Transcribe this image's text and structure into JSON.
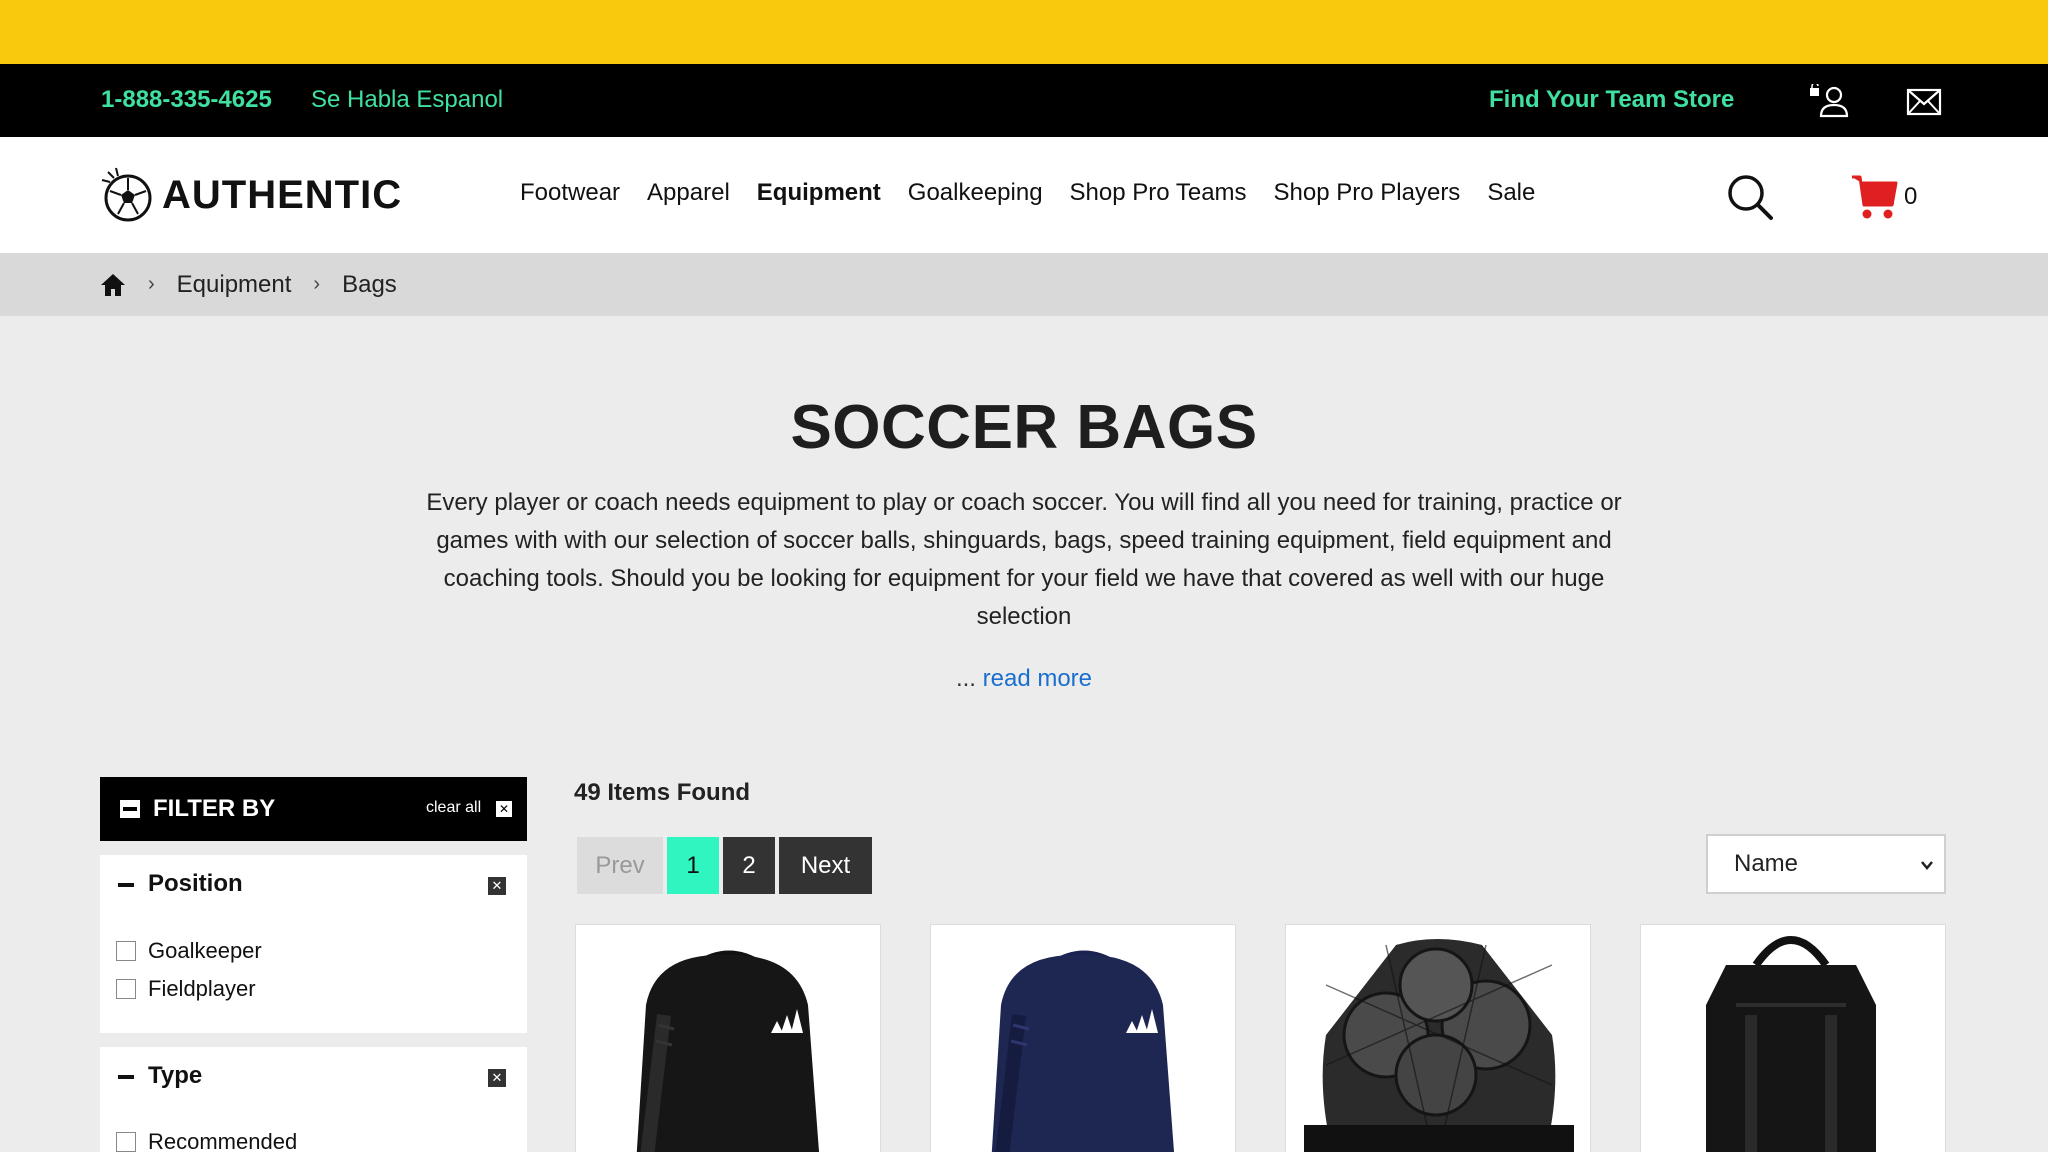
{
  "topbar": {
    "phone": "1-888-335-4625",
    "habla": "Se Habla Espanol",
    "team_store": "Find Your Team Store"
  },
  "header": {
    "logo_text": "AUTHENTIC",
    "nav": [
      "Footwear",
      "Apparel",
      "Equipment",
      "Goalkeeping",
      "Shop Pro Teams",
      "Shop Pro Players",
      "Sale"
    ],
    "active_nav": "Equipment",
    "cart_count": "0"
  },
  "breadcrumb": [
    "Equipment",
    "Bags"
  ],
  "main": {
    "title": "SOCCER BAGS",
    "intro": "Every player or coach needs equipment to play or coach soccer. You will find all you need for training, practice or games with with our selection of soccer balls, shinguards, bags, speed training equipment, field equipment and coaching tools. Should you be looking for equipment for your field we have that covered as well with our huge selection",
    "ellipsis": "...",
    "read_more": "read more"
  },
  "filters": {
    "header": "FILTER BY",
    "clear_all": "clear all",
    "groups": [
      {
        "title": "Position",
        "options": [
          "Goalkeeper",
          "Fieldplayer"
        ]
      },
      {
        "title": "Type",
        "options": [
          "Recommended"
        ]
      }
    ]
  },
  "results": {
    "count_label": "49 Items Found",
    "pager": {
      "prev": "Prev",
      "pages": [
        "1",
        "2"
      ],
      "current": "1",
      "next": "Next"
    },
    "sort": {
      "selected": "Name"
    }
  },
  "colors": {
    "promo": "#f8c90c",
    "accent_green": "#3fe0a0",
    "current_page": "#2ff5c0",
    "cart_red": "#e02020",
    "link_blue": "#1a6fce"
  },
  "icons": [
    "account-icon",
    "mail-icon",
    "search-icon",
    "cart-icon",
    "home-icon",
    "chevron-right-icon",
    "chevron-down-icon"
  ]
}
